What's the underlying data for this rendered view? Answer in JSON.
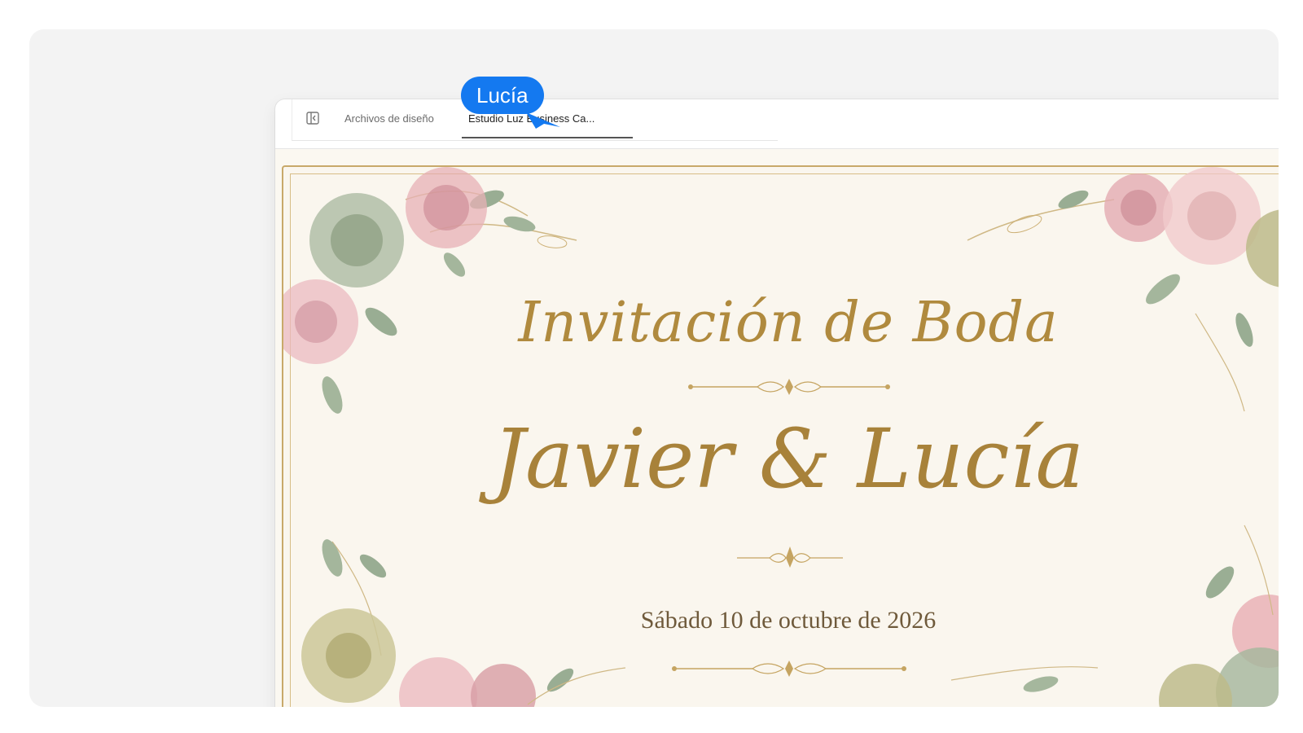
{
  "app": {
    "tabs": [
      {
        "label": "Archivos de diseño"
      },
      {
        "label": "Estudio Luz Business Ca..."
      }
    ]
  },
  "invitation": {
    "title": "Invitación de Boda",
    "names": "Javier & Lucía",
    "date": "Sábado 10 de octubre de 2026"
  },
  "collaborator": {
    "name": "Lucía",
    "color": "#1479f0"
  },
  "colors": {
    "gold": "#b08a3e",
    "paper": "#faf6ee",
    "rose": "#d79aa3",
    "sage": "#9cad8f"
  },
  "icons": {
    "sidebar_toggle": "sidebar-toggle-icon",
    "cursor": "cursor-arrow-icon"
  }
}
